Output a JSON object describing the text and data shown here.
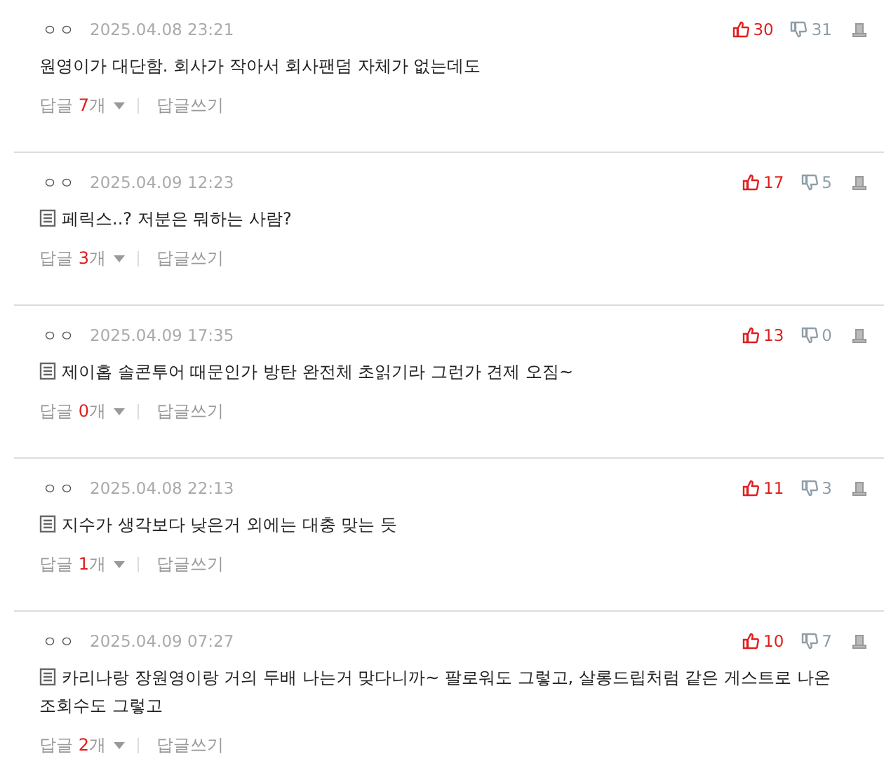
{
  "comments": [
    {
      "author": "ㅇㅇ",
      "date": "2025.04.08 23:21",
      "likes": "30",
      "dislikes": "31",
      "memo_icon": false,
      "text": "원영이가 대단함. 회사가 작아서 회사팬덤 자체가 없는데도",
      "replies": {
        "label": "답글",
        "count": "7",
        "unit": "개"
      },
      "write_reply": "답글쓰기"
    },
    {
      "author": "ㅇㅇ",
      "date": "2025.04.09 12:23",
      "likes": "17",
      "dislikes": "5",
      "memo_icon": true,
      "text": "페릭스..? 저분은 뭐하는 사람?",
      "replies": {
        "label": "답글",
        "count": "3",
        "unit": "개"
      },
      "write_reply": "답글쓰기"
    },
    {
      "author": "ㅇㅇ",
      "date": "2025.04.09 17:35",
      "likes": "13",
      "dislikes": "0",
      "memo_icon": true,
      "text": "제이홉 솔콘투어 때문인가 방탄 완전체 초읽기라 그런가 견제 오짐~",
      "replies": {
        "label": "답글",
        "count": "0",
        "unit": "개"
      },
      "write_reply": "답글쓰기"
    },
    {
      "author": "ㅇㅇ",
      "date": "2025.04.08 22:13",
      "likes": "11",
      "dislikes": "3",
      "memo_icon": true,
      "text": "지수가 생각보다 낮은거 외에는 대충 맞는 듯",
      "replies": {
        "label": "답글",
        "count": "1",
        "unit": "개"
      },
      "write_reply": "답글쓰기"
    },
    {
      "author": "ㅇㅇ",
      "date": "2025.04.09 07:27",
      "likes": "10",
      "dislikes": "7",
      "memo_icon": true,
      "text": "카리나랑 장원영이랑 거의 두배 나는거 맞다니까~ 팔로워도 그렇고, 살롱드립처럼 같은 게스트로 나온 조회수도 그렇고",
      "replies": {
        "label": "답글",
        "count": "2",
        "unit": "개"
      },
      "write_reply": "답글쓰기"
    }
  ]
}
